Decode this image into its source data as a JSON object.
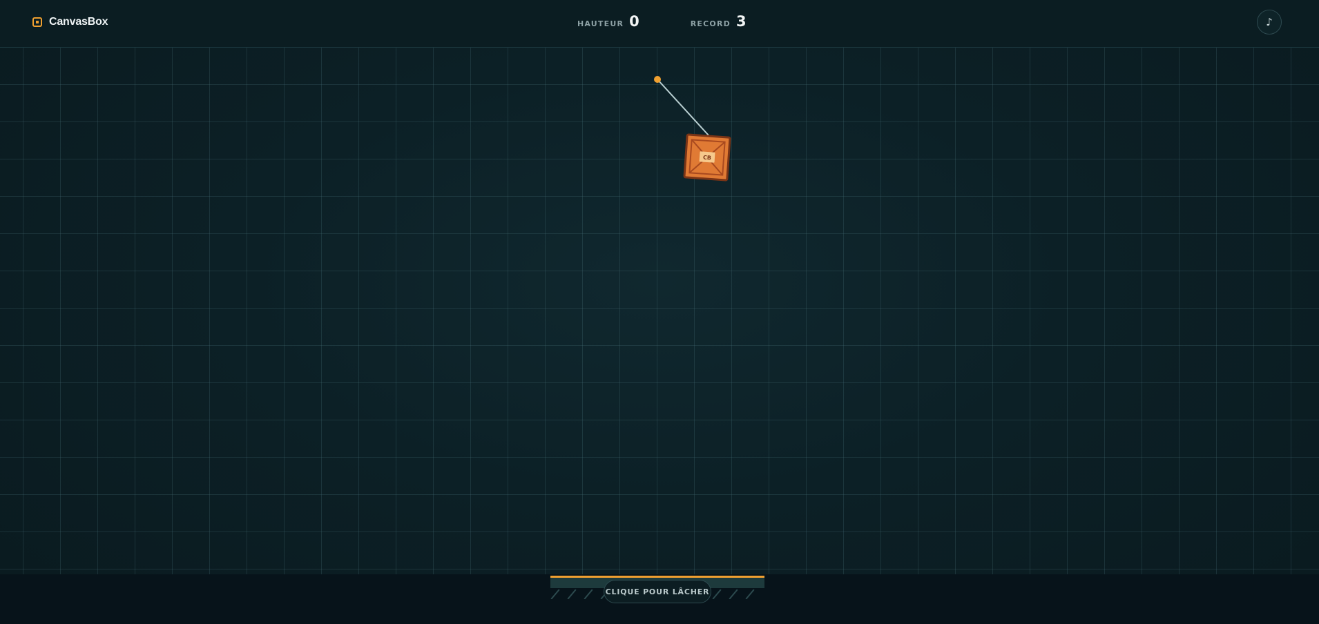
{
  "app": {
    "name": "CanvasBox"
  },
  "hud": {
    "height_label": "HAUTEUR",
    "height_value": "0",
    "record_label": "RECORD",
    "record_value": "3"
  },
  "sound_button": {
    "icon": "music-note-icon",
    "glyph": "♪"
  },
  "crate": {
    "label": "CB"
  },
  "hint": {
    "text": "CLIQUE POUR LÂCHER"
  },
  "colors": {
    "accent": "#f0a030",
    "crate": "#e07a34",
    "background": "#0a1a1f"
  }
}
